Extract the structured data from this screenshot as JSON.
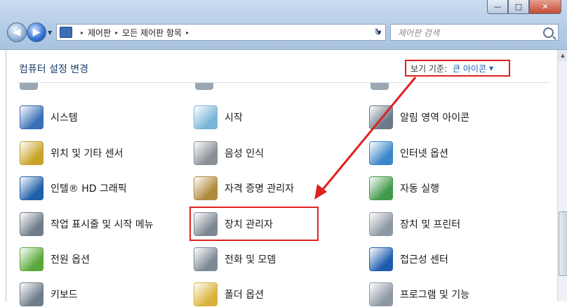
{
  "window": {
    "minimize_glyph": "—",
    "maximize_glyph": "□",
    "close_glyph": "✕"
  },
  "nav": {
    "back_glyph": "◀",
    "forward_glyph": "▶",
    "dropdown_glyph": "▼"
  },
  "address": {
    "breadcrumbs": [
      "제어판",
      "모든 제어판 항목"
    ],
    "separator_glyph": "▸",
    "dropdown_glyph": "▼",
    "refresh_glyph": "↻"
  },
  "search": {
    "placeholder": "제어판 검색"
  },
  "header": {
    "title": "컴퓨터 설정 변경",
    "view_by_label": "보기 기준:",
    "view_by_value": "큰 아이콘",
    "view_by_arrow": "▼"
  },
  "items": [
    {
      "label": "시스템",
      "icon": "system-icon",
      "col": 0,
      "row": 0,
      "color": "#3b6fb6"
    },
    {
      "label": "시작",
      "icon": "getting-started-icon",
      "col": 1,
      "row": 0,
      "color": "#7ab6d8"
    },
    {
      "label": "알림 영역 아이콘",
      "icon": "notification-area-icon",
      "col": 2,
      "row": 0,
      "color": "#6a7a88"
    },
    {
      "label": "위치 및 기타 센서",
      "icon": "location-sensor-icon",
      "col": 0,
      "row": 1,
      "color": "#c9a227"
    },
    {
      "label": "음성 인식",
      "icon": "microphone-icon",
      "col": 1,
      "row": 1,
      "color": "#8a8f96"
    },
    {
      "label": "인터넷 옵션",
      "icon": "internet-options-icon",
      "col": 2,
      "row": 1,
      "color": "#3a86c8"
    },
    {
      "label": "인텔® HD 그래픽",
      "icon": "intel-graphics-icon",
      "col": 0,
      "row": 2,
      "color": "#1f5fa8"
    },
    {
      "label": "자격 증명 관리자",
      "icon": "credential-vault-icon",
      "col": 1,
      "row": 2,
      "color": "#b08a3c"
    },
    {
      "label": "자동 실행",
      "icon": "autoplay-icon",
      "col": 2,
      "row": 2,
      "color": "#3f9a4a"
    },
    {
      "label": "작업 표시줄 및 시작 메뉴",
      "icon": "taskbar-icon",
      "col": 0,
      "row": 3,
      "color": "#6f7c8a"
    },
    {
      "label": "장치 관리자",
      "icon": "device-manager-icon",
      "col": 1,
      "row": 3,
      "color": "#7d8894"
    },
    {
      "label": "장치 및 프린터",
      "icon": "devices-printers-icon",
      "col": 2,
      "row": 3,
      "color": "#8e98a4"
    },
    {
      "label": "전원 옵션",
      "icon": "power-options-icon",
      "col": 0,
      "row": 4,
      "color": "#5aa83a"
    },
    {
      "label": "전화 및 모뎀",
      "icon": "phone-modem-icon",
      "col": 1,
      "row": 4,
      "color": "#7d8894"
    },
    {
      "label": "접근성 센터",
      "icon": "ease-of-access-icon",
      "col": 2,
      "row": 4,
      "color": "#1d5db0"
    },
    {
      "label": "키보드",
      "icon": "keyboard-icon",
      "col": 0,
      "row": 5,
      "color": "#6f7c8a"
    },
    {
      "label": "폴더 옵션",
      "icon": "folder-options-icon",
      "col": 1,
      "row": 5,
      "color": "#d9b23b"
    },
    {
      "label": "프로그램 및 기능",
      "icon": "programs-features-icon",
      "col": 2,
      "row": 5,
      "color": "#8e98a4"
    }
  ],
  "colors": {
    "annotation_red": "#e02020",
    "link_blue": "#1a5fb4"
  }
}
